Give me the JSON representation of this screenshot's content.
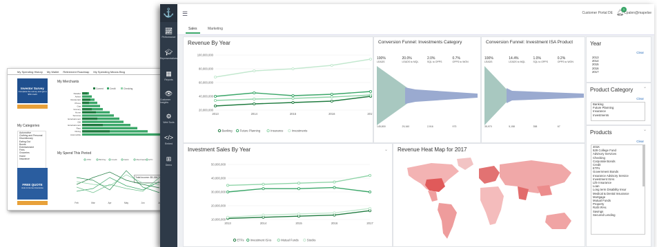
{
  "back_window": {
    "nav": [
      "My Spending History",
      "My Wallet",
      "Retirement Roadmap",
      "My Spending Means Blog"
    ],
    "ad_top": {
      "title": "Investor Survey",
      "text": "Complete the survey and get a $50 credit"
    },
    "merchants_title": "My Merchants",
    "merchants_legend": [
      "Current",
      "Credit",
      "Checking"
    ],
    "merchants": [
      "Retailer",
      "Airline",
      "Restaurant",
      "Phone",
      "Gas",
      "Grocery",
      "Home",
      "Services",
      "Entertainment",
      "Gift",
      "Entertainment",
      "Rent",
      "Dining",
      "Automobile"
    ],
    "tooltip": "Total income: $9,156.74",
    "categories_title": "My Categories",
    "categories_clear": "Clear",
    "categories": [
      "Automotive",
      "Clothing and Personal",
      "Discretionary",
      "Eating Out",
      "Bonds",
      "Entertainment",
      "Fees",
      "Groceries",
      "Home",
      "Insurance"
    ],
    "spend_title": "My Spend This Period",
    "spend_legend": [
      "ATM",
      "Bill Pay",
      "Credit",
      "Debit",
      "Merchants",
      "ETC"
    ],
    "spend_months": [
      "Feb",
      "Mar",
      "Apr",
      "May",
      "Jun",
      "Jul"
    ],
    "ad_bottom": {
      "title": "FREE QUOTE",
      "text": "Auto & Home insurance"
    }
  },
  "app": {
    "nav": [
      {
        "label": "Performance",
        "icon": "chart-icon"
      },
      {
        "label": "Representatives",
        "icon": "graduation-cap-icon"
      },
      {
        "label": "Reports",
        "icon": "table-icon"
      },
      {
        "label": "Customer Insights",
        "icon": "eye-icon"
      },
      {
        "label": "Web Tools",
        "icon": "gears-icon"
      },
      {
        "label": "Embed",
        "icon": "code-icon"
      },
      {
        "label": "Demo",
        "icon": "windows-icon"
      }
    ],
    "topbar": {
      "portal": "Customer Portal DE",
      "notifications": "1",
      "user": "Cpalen@mapelse"
    },
    "tabs": [
      "Sales",
      "Marketing"
    ]
  },
  "revenue": {
    "title": "Revenue By Year",
    "legend": [
      "Banking",
      "Future Planning",
      "Insurance",
      "Investments"
    ]
  },
  "funnel1": {
    "title": "Conversion Funnel: Investments Category",
    "stats": [
      {
        "label": "LEADS",
        "value": "100%"
      },
      {
        "label": "LEADS to MQL",
        "value": "20.0%"
      },
      {
        "label": "SQL to OPPS",
        "value": "2.0%"
      },
      {
        "label": "OPPS to WON",
        "value": "0.7%"
      }
    ],
    "bottom": [
      "145,800",
      "29,160",
      "2,916",
      "973"
    ]
  },
  "funnel2": {
    "title": "Conversion Funnel: Investment ISA Product",
    "stats": [
      {
        "label": "LEADS",
        "value": "100%"
      },
      {
        "label": "LEADS to MQL",
        "value": "14.4%"
      },
      {
        "label": "SQL to OPPS",
        "value": "1.0%"
      },
      {
        "label": "OPPS to WON",
        "value": "0.2%"
      }
    ],
    "bottom": [
      "35,970",
      "5,158",
      "358",
      "67"
    ]
  },
  "investment": {
    "title": "Investment Sales By Year",
    "legend": [
      "ETFs",
      "Investment ISAs",
      "Mutual Funds",
      "Stocks"
    ]
  },
  "heatmap": {
    "title": "Revenue Heat Map for 2017"
  },
  "year_filter": {
    "title": "Year",
    "clear": "Clear",
    "items": [
      "2013",
      "2014",
      "2015",
      "2016",
      "2017"
    ]
  },
  "category_filter": {
    "title": "Product Category",
    "clear": "Clear",
    "items": [
      "Banking",
      "Future Planning",
      "Insurance",
      "Investments"
    ]
  },
  "products_filter": {
    "title": "Products",
    "clear": "Clear",
    "items": [
      "401K",
      "529 College Fund",
      "Advisory Services",
      "Checking",
      "Corporate Bonds",
      "Credit",
      "ETFs",
      "Government Bonds",
      "Insurance Advisory Service",
      "Investment ISAs",
      "Life Insurance",
      "Loan",
      "Long term Disability Insur",
      "Medical & Dental Insurance",
      "Mortgage",
      "Mutual Funds",
      "Property",
      "Roth IRAs",
      "Savings",
      "Secured Lending"
    ]
  },
  "chart_data": [
    {
      "type": "line",
      "title": "Revenue By Year",
      "x": [
        "2013",
        "2014",
        "2015",
        "2016",
        "2017"
      ],
      "yticks": [
        "100,000,000",
        "80,000,000",
        "60,000,000",
        "40,000,000",
        "20,000,000"
      ],
      "ylim": [
        20000000,
        100000000
      ],
      "series": [
        {
          "name": "Banking",
          "color": "#1e7a3e",
          "values": [
            26000000,
            29000000,
            31000000,
            33000000,
            40000000
          ]
        },
        {
          "name": "Future Planning",
          "color": "#3aa668",
          "values": [
            40000000,
            45000000,
            41000000,
            43000000,
            47000000
          ]
        },
        {
          "name": "Insurance",
          "color": "#8fd4a8",
          "values": [
            34000000,
            36000000,
            37000000,
            39000000,
            42000000
          ]
        },
        {
          "name": "Investments",
          "color": "#c3e8cf",
          "values": [
            68000000,
            77000000,
            80000000,
            85000000,
            94000000
          ]
        }
      ]
    },
    {
      "type": "line",
      "title": "Investment Sales By Year",
      "x": [
        "2013",
        "2014",
        "2015",
        "2016",
        "2017"
      ],
      "yticks": [
        "50,000,000",
        "40,000,000",
        "30,000,000",
        "20,000,000",
        "10,000,000"
      ],
      "ylim": [
        0,
        50000000
      ],
      "series": [
        {
          "name": "ETFs",
          "color": "#1e7a3e",
          "values": [
            1000000,
            2000000,
            3000000,
            4000000,
            8000000
          ]
        },
        {
          "name": "Investment ISAs",
          "color": "#3aa668",
          "values": [
            25000000,
            28000000,
            28000000,
            29000000,
            25000000
          ]
        },
        {
          "name": "Mutual Funds",
          "color": "#8fd4a8",
          "values": [
            31000000,
            32000000,
            33000000,
            34000000,
            40000000
          ]
        },
        {
          "name": "Stocks",
          "color": "#c3e8cf",
          "values": [
            2000000,
            4000000,
            5000000,
            6000000,
            10000000
          ]
        }
      ]
    }
  ]
}
